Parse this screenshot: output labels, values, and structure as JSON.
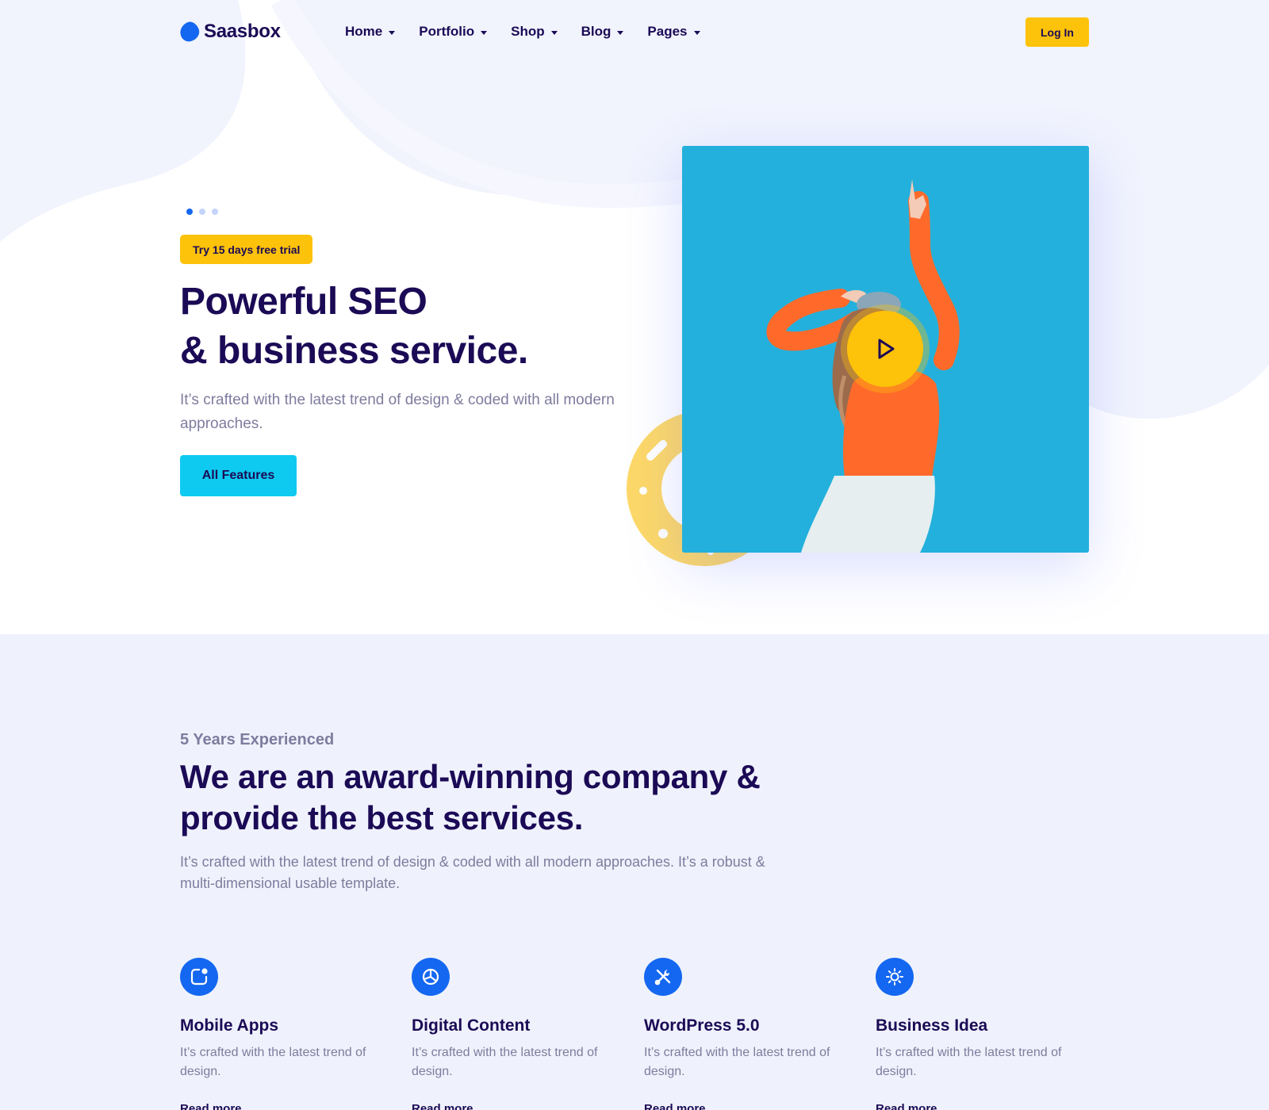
{
  "brand": {
    "name": "Saasbox"
  },
  "nav": {
    "items": [
      {
        "label": "Home"
      },
      {
        "label": "Portfolio"
      },
      {
        "label": "Shop"
      },
      {
        "label": "Blog"
      },
      {
        "label": "Pages"
      }
    ],
    "login_label": "Log In"
  },
  "hero": {
    "slider_dots": 3,
    "active_dot": 1,
    "badge": "Try 15 days free trial",
    "title_line1": "Powerful SEO",
    "title_line2": "& business service.",
    "description": "It’s crafted with the latest trend of design & coded with all modern approaches.",
    "cta_label": "All Features"
  },
  "services": {
    "eyebrow": "5 Years Experienced",
    "title_line1": "We are an award-winning company &",
    "title_line2": "provide the best services.",
    "description": "It’s crafted with the latest trend of design & coded with all modern approaches. It’s a robust & multi-dimensional usable template.",
    "features": [
      {
        "icon": "mobile-apps-icon",
        "title": "Mobile Apps",
        "description": "It’s crafted with the latest trend of design.",
        "link": "Read more"
      },
      {
        "icon": "pie-chart-icon",
        "title": "Digital Content",
        "description": "It’s crafted with the latest trend of design.",
        "link": "Read more"
      },
      {
        "icon": "tools-icon",
        "title": "WordPress 5.0",
        "description": "It’s crafted with the latest trend of design.",
        "link": "Read more"
      },
      {
        "icon": "sun-icon",
        "title": "Business Idea",
        "description": "It’s crafted with the latest trend of design.",
        "link": "Read more"
      }
    ]
  },
  "colors": {
    "primary": "#1467f0",
    "accent_yellow": "#fdc20a",
    "accent_cyan": "#0fcaf0",
    "heading": "#1b0a55",
    "muted": "#7e7c9e",
    "section_bg": "#eff2fc",
    "photo_bg": "#24b0dc"
  }
}
